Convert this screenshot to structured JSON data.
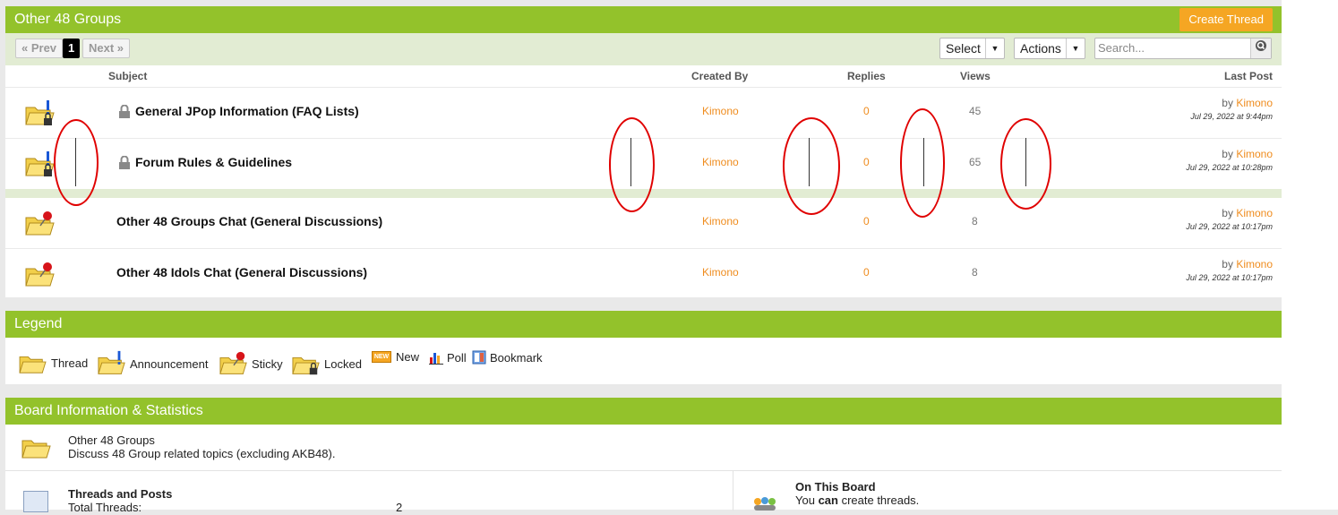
{
  "forum": {
    "title": "Other 48 Groups",
    "create_thread": "Create Thread",
    "pagination": {
      "prev": "« Prev",
      "current": "1",
      "next": "Next »"
    },
    "select_label": "Select",
    "actions_label": "Actions",
    "search_placeholder": "Search..."
  },
  "table": {
    "headers": {
      "subject": "Subject",
      "created_by": "Created By",
      "replies": "Replies",
      "views": "Views",
      "last_post": "Last Post"
    },
    "rows": [
      {
        "subject": "General JPop Information (FAQ Lists)",
        "creator": "Kimono",
        "replies": "0",
        "views": "45",
        "by": "by",
        "last_user": "Kimono",
        "last_date": "Jul 29, 2022 at 9:44pm",
        "type": "announcement-locked"
      },
      {
        "subject": "Forum Rules & Guidelines",
        "creator": "Kimono",
        "replies": "0",
        "views": "65",
        "by": "by",
        "last_user": "Kimono",
        "last_date": "Jul 29, 2022 at 10:28pm",
        "type": "announcement-locked"
      },
      {
        "subject": "Other 48 Groups Chat (General Discussions)",
        "creator": "Kimono",
        "replies": "0",
        "views": "8",
        "by": "by",
        "last_user": "Kimono",
        "last_date": "Jul 29, 2022 at 10:17pm",
        "type": "sticky"
      },
      {
        "subject": "Other 48 Idols Chat (General Discussions)",
        "creator": "Kimono",
        "replies": "0",
        "views": "8",
        "by": "by",
        "last_user": "Kimono",
        "last_date": "Jul 29, 2022 at 10:17pm",
        "type": "sticky"
      }
    ]
  },
  "legend": {
    "title": "Legend",
    "items": [
      "Thread",
      "Announcement",
      "Sticky",
      "Locked",
      "New",
      "Poll",
      "Bookmark"
    ],
    "new_badge": "NEW"
  },
  "board_info": {
    "title": "Board Information & Statistics",
    "board_name": "Other 48 Groups",
    "board_desc": "Discuss 48 Group related topics (excluding AKB48).",
    "threads_posts_title": "Threads and Posts",
    "total_threads_label": "Total Threads:",
    "total_threads_value": "2",
    "on_board_title": "On This Board",
    "on_board_pre": "You ",
    "on_board_can": "can",
    "on_board_post": " create threads."
  },
  "colors": {
    "accent_green": "#93c22b",
    "orange": "#f5a623",
    "link_orange": "#ef8c1e",
    "annotation_red": "#e00000"
  },
  "icons": [
    "folder-icon",
    "announcement-icon",
    "sticky-pin-icon",
    "lock-icon",
    "new-badge-icon",
    "poll-icon",
    "bookmark-icon",
    "search-icon",
    "users-icon",
    "stats-icon"
  ]
}
